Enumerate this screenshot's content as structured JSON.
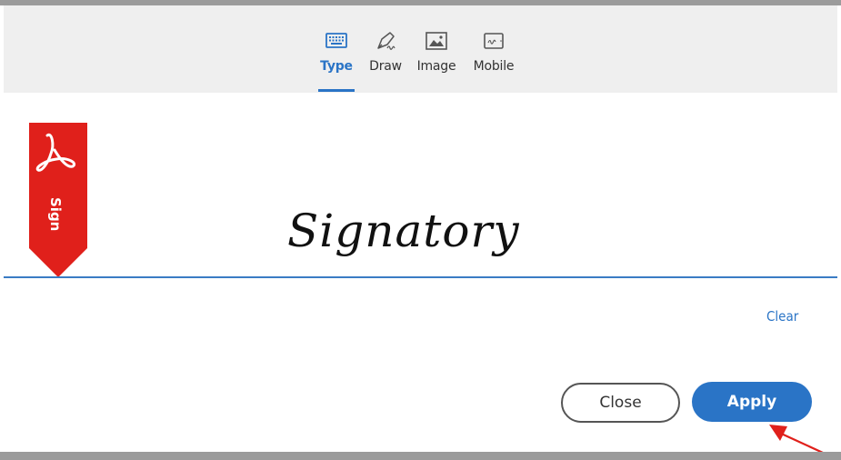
{
  "tabs": [
    {
      "label": "Type",
      "icon": "keyboard-icon",
      "active": true
    },
    {
      "label": "Draw",
      "icon": "pen-icon",
      "active": false
    },
    {
      "label": "Image",
      "icon": "image-icon",
      "active": false
    },
    {
      "label": "Mobile",
      "icon": "mobile-icon",
      "active": false
    }
  ],
  "ribbon": {
    "label": "Sign",
    "icon": "acrobat-icon",
    "color": "#e0201b"
  },
  "signature": {
    "text": "Signatory"
  },
  "actions": {
    "clear_label": "Clear",
    "close_label": "Close",
    "apply_label": "Apply"
  },
  "colors": {
    "accent": "#2a74c6",
    "ribbon": "#e0201b",
    "arrow": "#e0201b"
  }
}
